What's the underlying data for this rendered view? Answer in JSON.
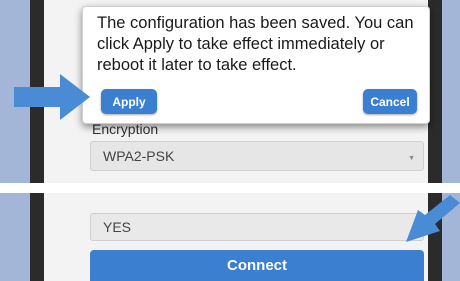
{
  "dialog": {
    "message": "The configuration has been saved. You can click Apply to take effect immediately or reboot it later to take effect.",
    "apply_label": "Apply",
    "cancel_label": "Cancel"
  },
  "encryption": {
    "label": "Encryption",
    "value": "WPA2-PSK"
  },
  "yes_field": {
    "value": "YES"
  },
  "connect_label": "Connect",
  "icons": {
    "pointer_left": "arrow-right-icon",
    "pointer_right": "arrow-down-left-icon",
    "select_caret": "caret-down-icon"
  },
  "colors": {
    "button_blue": "#3a7fd0",
    "arrow_blue": "#4a8bd6",
    "bezel": "#a4b6d7",
    "frame": "#2b2b2b"
  }
}
